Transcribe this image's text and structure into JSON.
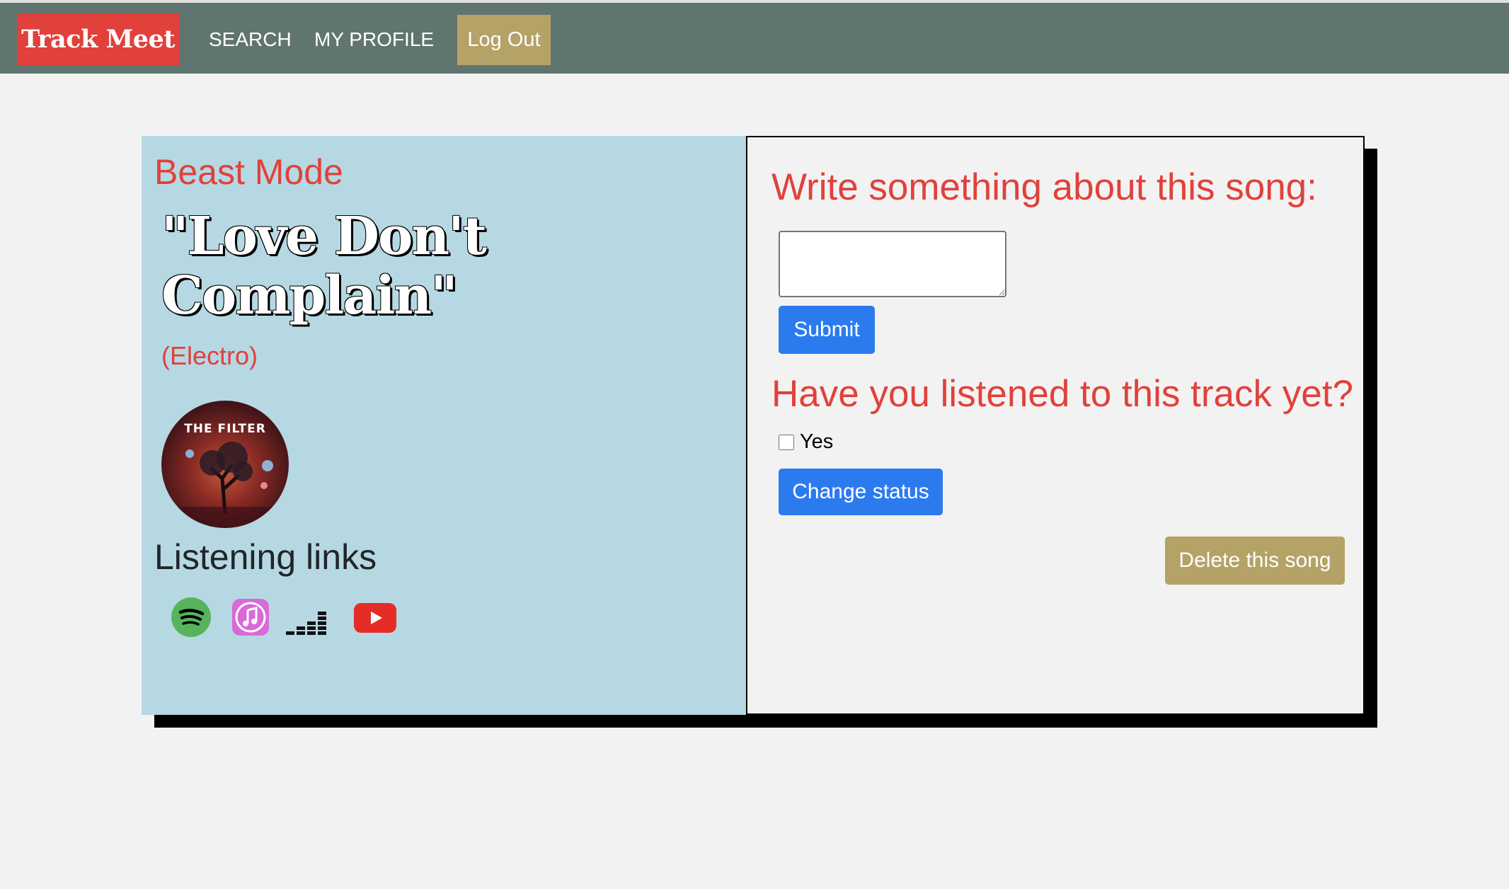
{
  "nav": {
    "brand": "Track Meet",
    "search": "SEARCH",
    "profile": "MY PROFILE",
    "logout": "Log Out"
  },
  "song": {
    "artist": "Beast Mode",
    "title": "\"Love Don't Complain\"",
    "genre": "(Electro)",
    "cover_text": "THE FILTER"
  },
  "links": {
    "heading": "Listening links",
    "icons": [
      "spotify-icon",
      "itunes-icon",
      "deezer-icon",
      "youtube-icon"
    ]
  },
  "comment": {
    "heading": "Write something about this song:",
    "placeholder": "",
    "submit": "Submit"
  },
  "status": {
    "heading": "Have you listened to this track yet?",
    "yes_label": "Yes",
    "checked": false,
    "change_button": "Change status"
  },
  "delete_button": "Delete this song",
  "colors": {
    "navbar": "#60756f",
    "brand": "#e1413b",
    "accent_gold": "#b5a267",
    "left_panel": "#b6d8e3",
    "primary_button": "#2b7bef",
    "heading_red": "#e1413b"
  }
}
